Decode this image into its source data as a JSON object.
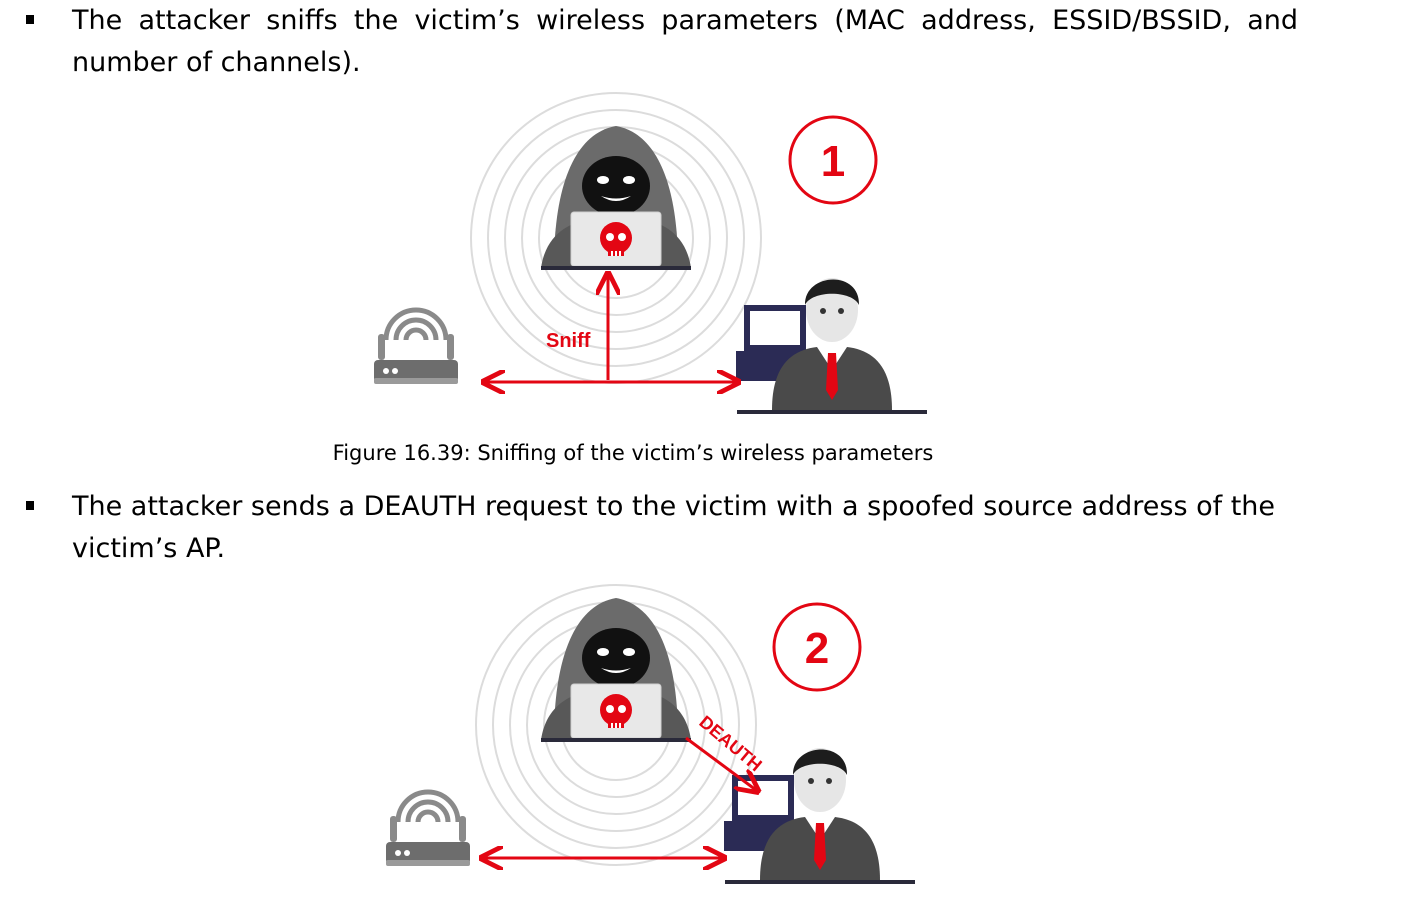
{
  "bullets": [
    "The attacker sniffs the victim’s wireless parameters (MAC address, ESSID/BSSID, and number of channels).",
    "The attacker sends a DEAUTH request to the victim with a spoofed source address of the victim’s AP."
  ],
  "figure1": {
    "step": "1",
    "arrow_label": "Sniff",
    "caption": "Figure 16.39: Sniffing of the victim’s wireless parameters"
  },
  "figure2": {
    "step": "2",
    "arrow_label": "DEAUTH"
  },
  "colors": {
    "accent": "#e30613",
    "dark": "#2a2a3a",
    "grey": "#6d6d6d"
  }
}
